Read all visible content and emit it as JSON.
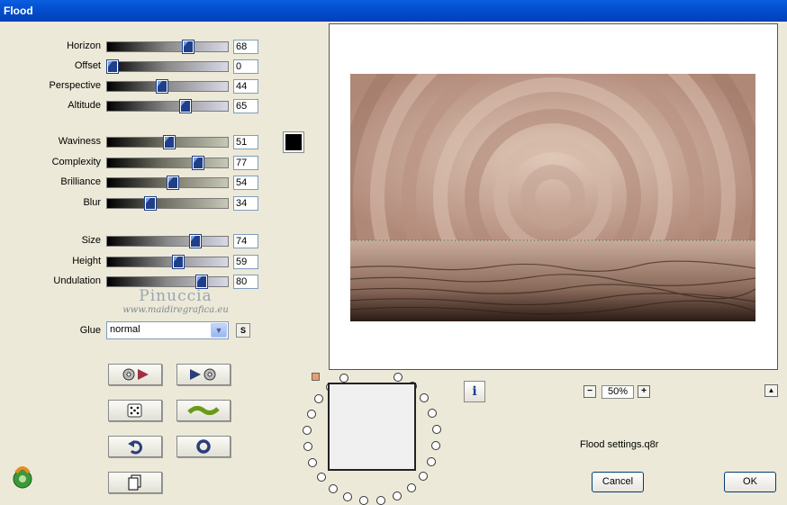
{
  "window": {
    "title": "Flood"
  },
  "sliders_group1": [
    {
      "label": "Horizon",
      "value": "68",
      "thumb": 0.68
    },
    {
      "label": "Offset",
      "value": "0",
      "thumb": 0.0
    },
    {
      "label": "Perspective",
      "value": "44",
      "thumb": 0.44
    },
    {
      "label": "Altitude",
      "value": "65",
      "thumb": 0.65
    }
  ],
  "sliders_group2": [
    {
      "label": "Waviness",
      "value": "51",
      "thumb": 0.51
    },
    {
      "label": "Complexity",
      "value": "77",
      "thumb": 0.77
    },
    {
      "label": "Brilliance",
      "value": "54",
      "thumb": 0.54
    },
    {
      "label": "Blur",
      "value": "34",
      "thumb": 0.34
    }
  ],
  "sliders_group3": [
    {
      "label": "Size",
      "value": "74",
      "thumb": 0.74
    },
    {
      "label": "Height",
      "value": "59",
      "thumb": 0.59
    },
    {
      "label": "Undulation",
      "value": "80",
      "thumb": 0.8
    }
  ],
  "color_swatch": "#000000",
  "watermark": {
    "name": "Pinuccia",
    "site": "www.maidiregrafica.eu"
  },
  "glue": {
    "label": "Glue",
    "value": "normal",
    "s_button": "S"
  },
  "zoom": {
    "minus": "−",
    "value": "50%",
    "plus": "+"
  },
  "info_button": "i",
  "settings_file": "Flood settings.q8r",
  "buttons": {
    "cancel": "Cancel",
    "ok": "OK"
  }
}
